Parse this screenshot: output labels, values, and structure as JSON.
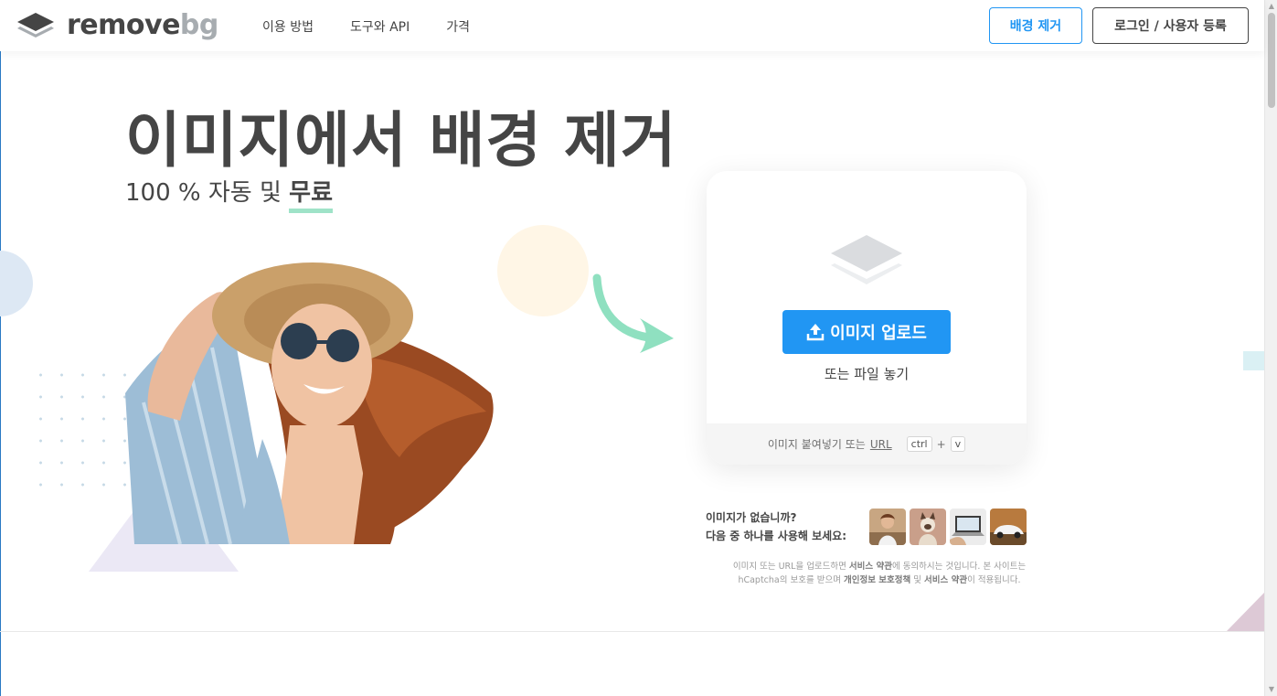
{
  "header": {
    "logo": {
      "part1": "remove",
      "part2": "bg"
    },
    "nav": [
      "이용 방법",
      "도구와 API",
      "가격"
    ],
    "remove_bg_button": "배경 제거",
    "login_button": "로그인 / 사용자 등록"
  },
  "hero": {
    "title": "이미지에서 배경 제거",
    "subtitle_prefix": "100 % 자동 및",
    "subtitle_highlight": "무료"
  },
  "upload": {
    "button_label": "이미지 업로드",
    "drop_text": "또는 파일 놓기",
    "paste_text": "이미지 붙여넣기 또는",
    "url_label": "URL",
    "key_ctrl": "ctrl",
    "plus": "+",
    "key_v": "v"
  },
  "samples": {
    "line1": "이미지가 없습니까?",
    "line2": "다음 중 하나를 사용해 보세요:",
    "items": [
      "woman",
      "cat",
      "laptop",
      "car"
    ]
  },
  "terms": {
    "t1": "이미지 또는 URL을 업로드하면",
    "t2": "서비스 약관",
    "t3": "에 동의하시는 것입니다. 본 사이트는",
    "t4": "hCaptcha의 보호를 받으며",
    "t5": "개인정보 보호정책",
    "t6": "및",
    "t7": "서비스 약관",
    "t8": "이 적용됩니다."
  },
  "colors": {
    "primary": "#2196f3",
    "text": "#454545",
    "accent_mint": "#9fe3c8"
  },
  "icons": [
    "logo-stack-icon",
    "upload-icon",
    "layers-icon",
    "curved-arrow-icon"
  ]
}
